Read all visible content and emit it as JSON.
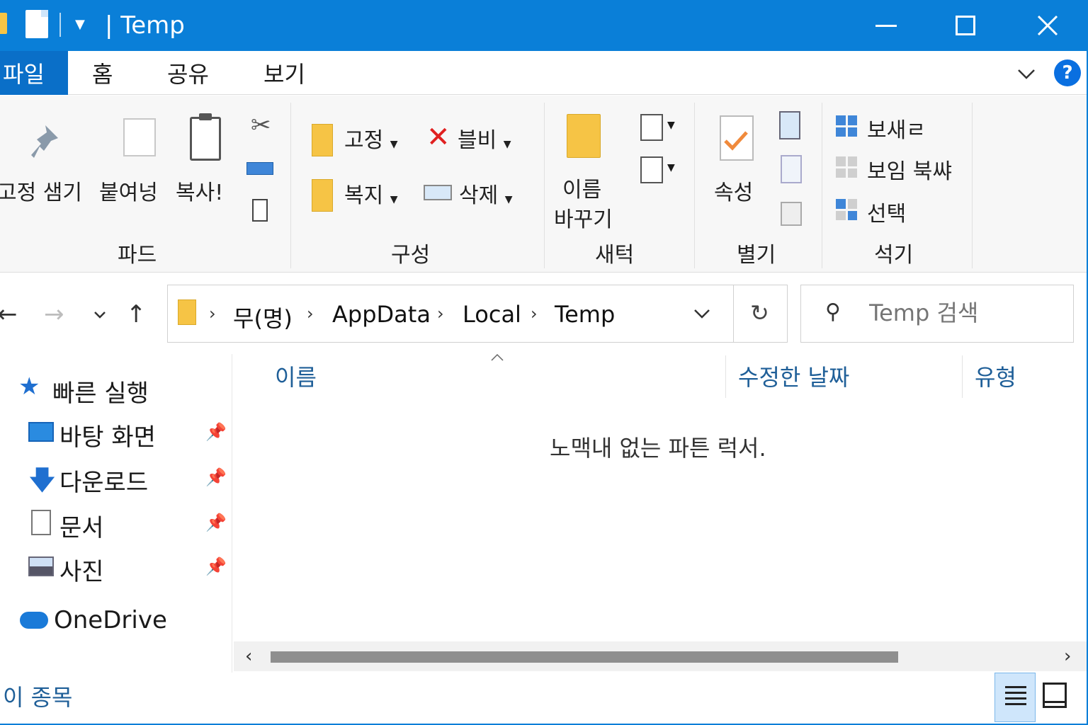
{
  "titlebar": {
    "title": "| Temp",
    "minimize_icon": "minimize-icon",
    "maximize_icon": "maximize-icon",
    "close_icon": "close-icon"
  },
  "ribbon_tabs": {
    "file": "파일",
    "home": "홈",
    "share": "공유",
    "view": "보기"
  },
  "ribbon": {
    "clipboard": {
      "pin_label": "고정 샘기",
      "paste_label": "붙여넝",
      "copy_label": "복사!",
      "group_label": "파드"
    },
    "organize": {
      "move_to": "고정",
      "copy_to": "복지",
      "delete": "블비",
      "rename": "삭제",
      "group_label": "구성"
    },
    "new": {
      "new_folder": "이름",
      "new_folder_line2": "바꾸기",
      "group_label": "새턱"
    },
    "open": {
      "properties": "속성",
      "group_label": "별기"
    },
    "select": {
      "select_all": "보새ㄹ",
      "select_none": "보임 북쌰",
      "invert": "선택",
      "group_label": "석기"
    }
  },
  "nav": {
    "breadcrumb": [
      "무(명)",
      "AppData",
      "Local",
      "Temp"
    ],
    "search_placeholder": "Temp 검색"
  },
  "navpane": {
    "quick_access": "빠른 실행",
    "items": [
      {
        "label": "바탕 화면",
        "icon": "desktop-icon"
      },
      {
        "label": "다운로드",
        "icon": "download-icon"
      },
      {
        "label": "문서",
        "icon": "document-icon"
      },
      {
        "label": "사진",
        "icon": "pictures-icon"
      }
    ],
    "onedrive": "OneDrive"
  },
  "content": {
    "columns": [
      "이름",
      "수정한 날짜",
      "유형"
    ],
    "empty_message": "노맥내 없는 파튼 럭서."
  },
  "status": {
    "item_count": "이 종목"
  },
  "colors": {
    "titlebar": "#0a7fd8",
    "file_tab": "#0a6fc8",
    "accent_text": "#1f5f98"
  }
}
